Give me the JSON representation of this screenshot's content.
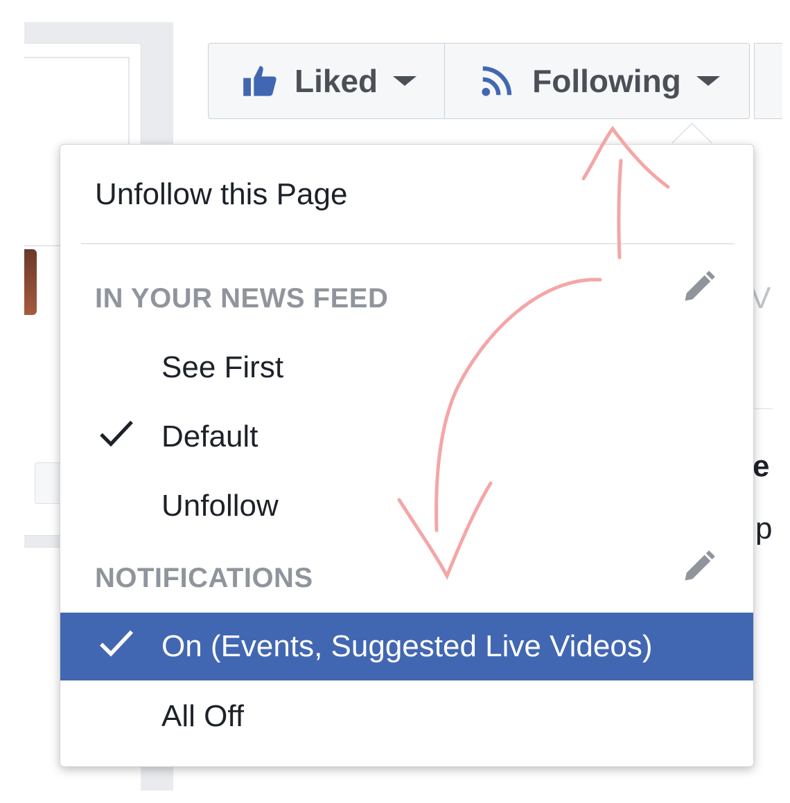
{
  "buttons": {
    "liked": "Liked",
    "following": "Following"
  },
  "menu": {
    "unfollow_page": "Unfollow this Page",
    "news_feed_title": "IN YOUR NEWS FEED",
    "news_feed_options": [
      "See First",
      "Default",
      "Unfollow"
    ],
    "news_feed_selected": "Default",
    "notifications_title": "NOTIFICATIONS",
    "notification_options": [
      "On (Events, Suggested Live Videos)",
      "All Off"
    ],
    "notifications_selected": "On (Events, Suggested Live Videos)"
  },
  "background": {
    "right_letter_1": "V",
    "right_letter_2": "e",
    "right_letter_3": "p"
  },
  "colors": {
    "accent": "#4267b2",
    "icon_blue": "#4267b2",
    "annotation": "#f4a6a6",
    "section_gray": "#90949c"
  },
  "icons": [
    "thumbs-up-icon",
    "rss-feed-icon",
    "caret-down-icon",
    "pencil-icon",
    "checkmark-icon"
  ]
}
